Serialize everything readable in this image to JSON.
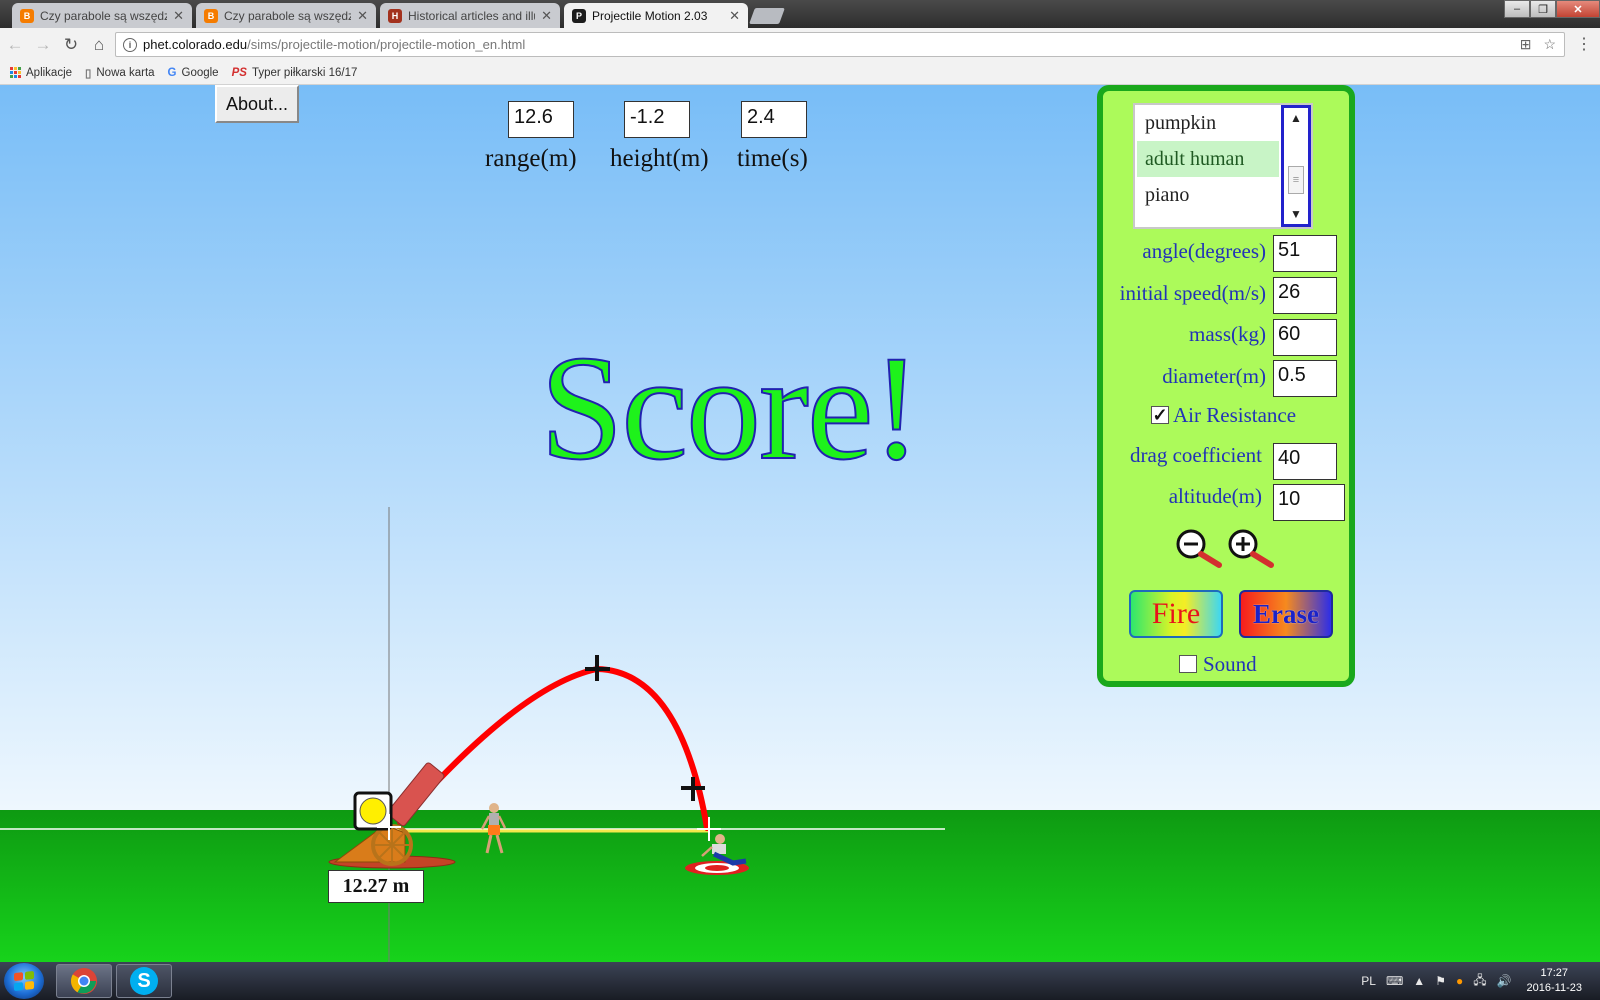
{
  "browser": {
    "tabs": [
      {
        "label": "Czy parabole są wszędzie",
        "favicon_color": "#f57c00",
        "favicon": "B"
      },
      {
        "label": "Czy parabole są wszędzie",
        "favicon_color": "#f57c00",
        "favicon": "B"
      },
      {
        "label": "Historical articles and illu",
        "favicon_color": "#a3321e",
        "favicon": "H"
      },
      {
        "label": "Projectile Motion 2.03",
        "favicon_color": "#1c1c1c",
        "favicon": "P"
      }
    ],
    "url_host": "phet.colorado.edu",
    "url_path": "/sims/projectile-motion/projectile-motion_en.html",
    "bookmarks": [
      {
        "label": "Aplikacje",
        "icon": "apps-grid-icon"
      },
      {
        "label": "Nowa karta",
        "icon": "page-icon"
      },
      {
        "label": "Google",
        "icon": "google-icon"
      },
      {
        "label": "Typer piłkarski 16/17",
        "icon": "ps-icon"
      }
    ]
  },
  "sim": {
    "about_label": "About...",
    "readouts": {
      "range": {
        "value": "12.6",
        "label": "range(m)"
      },
      "height": {
        "value": "-1.2",
        "label": "height(m)"
      },
      "time": {
        "value": "2.4",
        "label": "time(s)"
      }
    },
    "score_text": "Score!",
    "range_marker": "12.27 m",
    "projectiles": {
      "items": [
        "pumpkin",
        "adult human",
        "piano"
      ],
      "selected": "adult human"
    },
    "params": {
      "angle": {
        "label": "angle(degrees)",
        "value": "51"
      },
      "speed": {
        "label": "initial speed(m/s)",
        "value": "26"
      },
      "mass": {
        "label": "mass(kg)",
        "value": "60"
      },
      "diameter": {
        "label": "diameter(m)",
        "value": "0.5"
      },
      "drag": {
        "label": "drag coefficient",
        "value": "40"
      },
      "altitude": {
        "label": "altitude(m)",
        "value": "10"
      }
    },
    "air_resistance": {
      "label": "Air Resistance",
      "checked": true
    },
    "sound": {
      "label": "Sound",
      "checked": false
    },
    "fire_label": "Fire",
    "erase_label": "Erase",
    "colors": {
      "trajectory": "#ff0000",
      "score_fill": "#1ef21b",
      "score_outline": "#2222b0",
      "panel_bg": "#acfa5a",
      "panel_border": "#1aa81c",
      "ground": "#17d31b",
      "sky": "#78bdf7"
    }
  },
  "taskbar": {
    "lang": "PL",
    "time": "17:27",
    "date": "2016-11-23"
  }
}
